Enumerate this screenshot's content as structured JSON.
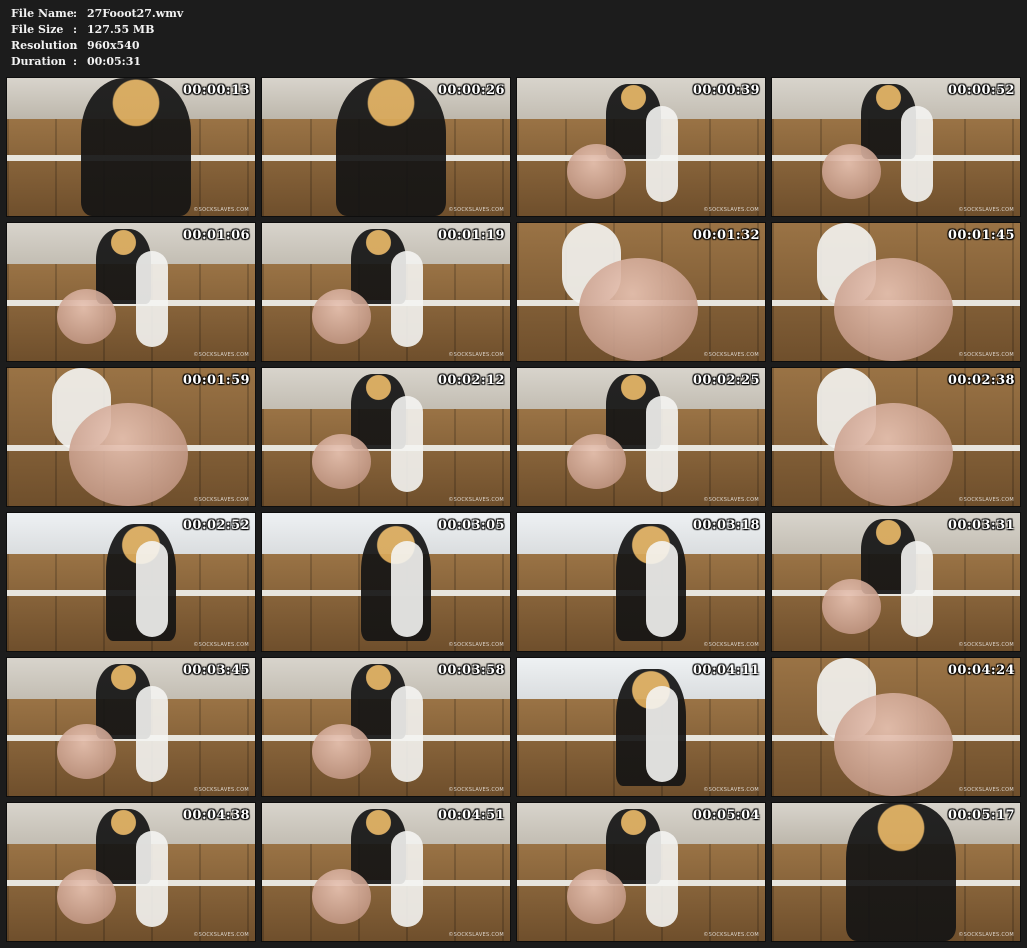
{
  "file_info": [
    {
      "key": "File Name",
      "sep": ":",
      "value": "27Fooot27.wmv"
    },
    {
      "key": "File Size",
      "sep": ":",
      "value": "127.55 MB"
    },
    {
      "key": "Resolution",
      "sep": ":",
      "value": "960x540"
    },
    {
      "key": "Duration",
      "sep": ":",
      "value": "00:05:31"
    }
  ],
  "watermark": "©SOCKSLAVES.COM",
  "thumbnails": [
    {
      "time": "00:00:13",
      "variant": "v1"
    },
    {
      "time": "00:00:26",
      "variant": "v1"
    },
    {
      "time": "00:00:39",
      "variant": "v2"
    },
    {
      "time": "00:00:52",
      "variant": "v2"
    },
    {
      "time": "00:01:06",
      "variant": "v2"
    },
    {
      "time": "00:01:19",
      "variant": "v2"
    },
    {
      "time": "00:01:32",
      "variant": "v3"
    },
    {
      "time": "00:01:45",
      "variant": "v3"
    },
    {
      "time": "00:01:59",
      "variant": "v3"
    },
    {
      "time": "00:02:12",
      "variant": "v2"
    },
    {
      "time": "00:02:25",
      "variant": "v2"
    },
    {
      "time": "00:02:38",
      "variant": "v3"
    },
    {
      "time": "00:02:52",
      "variant": "v4"
    },
    {
      "time": "00:03:05",
      "variant": "v4"
    },
    {
      "time": "00:03:18",
      "variant": "v4"
    },
    {
      "time": "00:03:31",
      "variant": "v2"
    },
    {
      "time": "00:03:45",
      "variant": "v2"
    },
    {
      "time": "00:03:58",
      "variant": "v2"
    },
    {
      "time": "00:04:11",
      "variant": "v4"
    },
    {
      "time": "00:04:24",
      "variant": "v3"
    },
    {
      "time": "00:04:38",
      "variant": "v2"
    },
    {
      "time": "00:04:51",
      "variant": "v2"
    },
    {
      "time": "00:05:04",
      "variant": "v2"
    },
    {
      "time": "00:05:17",
      "variant": "v1"
    }
  ]
}
